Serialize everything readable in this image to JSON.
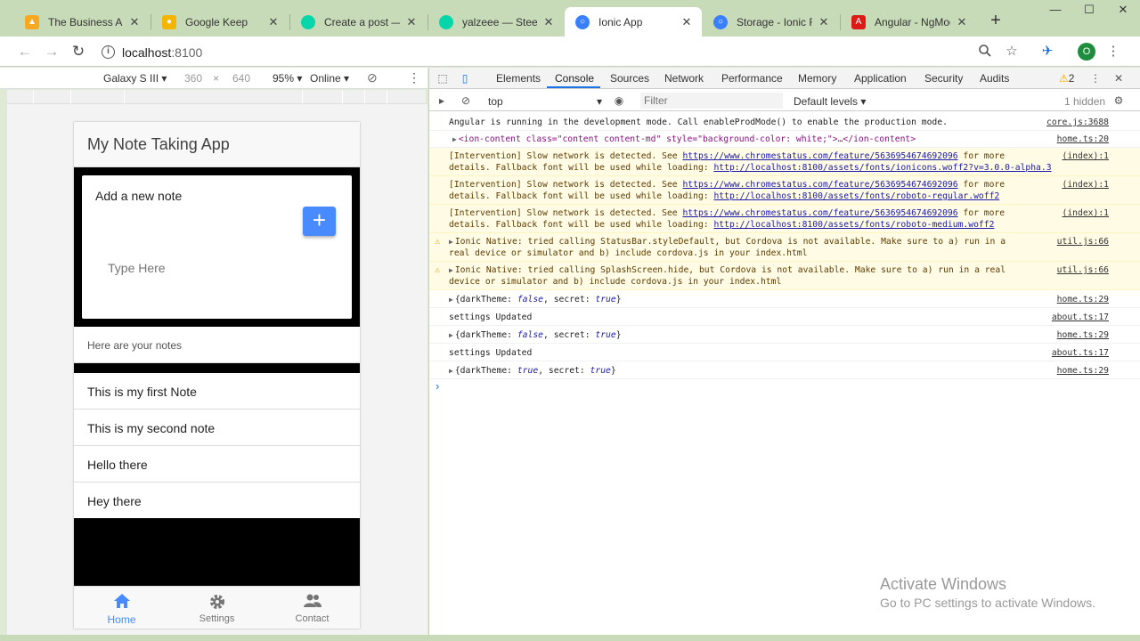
{
  "browser": {
    "tabs": [
      {
        "title": "The Business App -",
        "icon": "flame-icon",
        "color": "#f6a821"
      },
      {
        "title": "Google Keep",
        "icon": "bulb-icon",
        "color": "#f4b400"
      },
      {
        "title": "Create a post — St",
        "icon": "steemit-icon",
        "color": "#06d6a9"
      },
      {
        "title": "yalzeee — Steemit",
        "icon": "steemit-icon",
        "color": "#06d6a9"
      },
      {
        "title": "Ionic App",
        "icon": "ionic-icon",
        "color": "#3880ff"
      },
      {
        "title": "Storage - Ionic Fra",
        "icon": "ionic-icon",
        "color": "#3880ff"
      },
      {
        "title": "Angular - NgMode",
        "icon": "angular-icon",
        "color": "#dd1b16"
      }
    ],
    "active_tab": 4,
    "address_host": "localhost",
    "address_port": ":8100",
    "profile_initial": "O"
  },
  "device_toolbar": {
    "device": "Galaxy S III",
    "width": "360",
    "times": "×",
    "height": "640",
    "zoom": "95%",
    "network": "Online"
  },
  "app": {
    "title": "My Note Taking App",
    "card_label": "Add a new note",
    "add_button": "+",
    "input_placeholder": "Type Here",
    "list_header": "Here are your notes",
    "notes": [
      "This is my first Note",
      "This is my second note",
      "Hello there",
      "Hey there"
    ],
    "tabs": [
      {
        "label": "Home",
        "icon": "home-icon"
      },
      {
        "label": "Settings",
        "icon": "gear-icon"
      },
      {
        "label": "Contact",
        "icon": "contacts-icon"
      }
    ],
    "accent": "#488aff"
  },
  "devtools": {
    "tabs": [
      "Elements",
      "Console",
      "Sources",
      "Network",
      "Performance",
      "Memory",
      "Application",
      "Security",
      "Audits"
    ],
    "active_tab": "Console",
    "warnings_count": "2",
    "context": "top",
    "filter_placeholder": "Filter",
    "levels": "Default levels",
    "hidden": "1 hidden",
    "messages": [
      {
        "text": "Angular is running in the development mode. Call enableProdMode() to enable the production mode.",
        "src": "core.js:3688"
      },
      {
        "text": "<ion-content class=\"content content-md\" style=\"background-color: white;\">…</ion-content>",
        "src": "home.ts:20"
      },
      {
        "text1": "[Intervention] Slow network is detected. See ",
        "link": "https://www.chromestatus.com/feature/5636954674692096",
        "text2": " for more",
        "text3": "details. Fallback font will be used while loading: ",
        "url": "http://localhost:8100/assets/fonts/ionicons.woff2?v=3.0.0-alpha.3",
        "src": "(index):1"
      },
      {
        "text1": "[Intervention] Slow network is detected. See ",
        "link": "https://www.chromestatus.com/feature/5636954674692096",
        "text2": " for more",
        "text3": "details. Fallback font will be used while loading: ",
        "url": "http://localhost:8100/assets/fonts/roboto-regular.woff2",
        "src": "(index):1"
      },
      {
        "text1": "[Intervention] Slow network is detected. See ",
        "link": "https://www.chromestatus.com/feature/5636954674692096",
        "text2": " for more",
        "text3": "details. Fallback font will be used while loading: ",
        "url": "http://localhost:8100/assets/fonts/roboto-medium.woff2",
        "src": "(index):1"
      },
      {
        "line1": "Ionic Native: tried calling StatusBar.styleDefault, but Cordova is not available. Make sure to a) run in a",
        "line2": "real device or simulator and b) include cordova.js in your index.html",
        "src": "util.js:66"
      },
      {
        "line1": "Ionic Native: tried calling SplashScreen.hide, but Cordova is not available. Make sure to a) run in a real",
        "line2": "device or simulator and b) include cordova.js in your index.html",
        "src": "util.js:66"
      },
      {
        "dark": "false",
        "secret": "true",
        "src": "home.ts:29"
      },
      {
        "text": "settings Updated",
        "src": "about.ts:17"
      },
      {
        "dark": "false",
        "secret": "true",
        "src": "home.ts:29"
      },
      {
        "text": "settings Updated",
        "src": "about.ts:17"
      },
      {
        "dark": "true",
        "secret": "true",
        "src": "home.ts:29"
      }
    ],
    "obj_darkTheme": "darkTheme",
    "obj_secret": "secret"
  },
  "watermark": {
    "line1": "Activate Windows",
    "line2": "Go to PC settings to activate Windows."
  }
}
